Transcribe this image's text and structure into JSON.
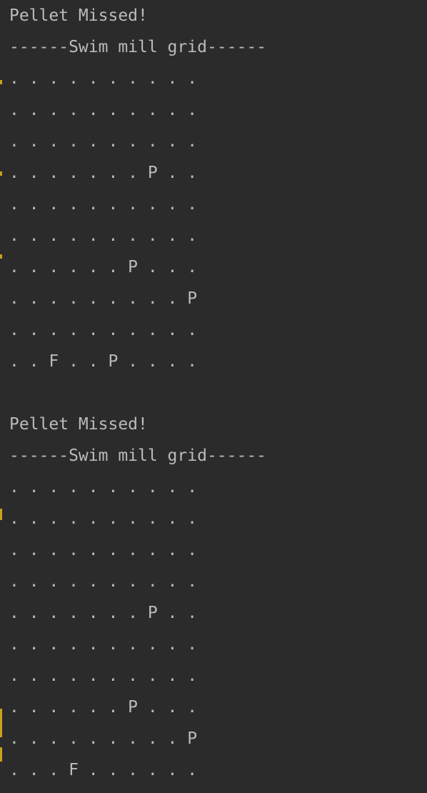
{
  "console": {
    "lines": [
      "Pellet Missed!",
      "------Swim mill grid------",
      ". . . . . . . . . .",
      ". . . . . . . . . .",
      ". . . . . . . . . .",
      ". . . . . . . P . .",
      ". . . . . . . . . .",
      ". . . . . . . . . .",
      ". . . . . . P . . .",
      ". . . . . . . . . P",
      ". . . . . . . . . .",
      ". . F . . P . . . .",
      "",
      "Pellet Missed!",
      "------Swim mill grid------",
      ". . . . . . . . . .",
      ". . . . . . . . . .",
      ". . . . . . . . . .",
      ". . . . . . . . . .",
      ". . . . . . . P . .",
      ". . . . . . . . . .",
      ". . . . . . . . . .",
      ". . . . . . P . . .",
      ". . . . . . . . . P",
      ". . . F . . . . . ."
    ]
  },
  "colors": {
    "background": "#2b2b2b",
    "text": "#bbbbbb",
    "gutter_marker": "#c8a21a"
  }
}
